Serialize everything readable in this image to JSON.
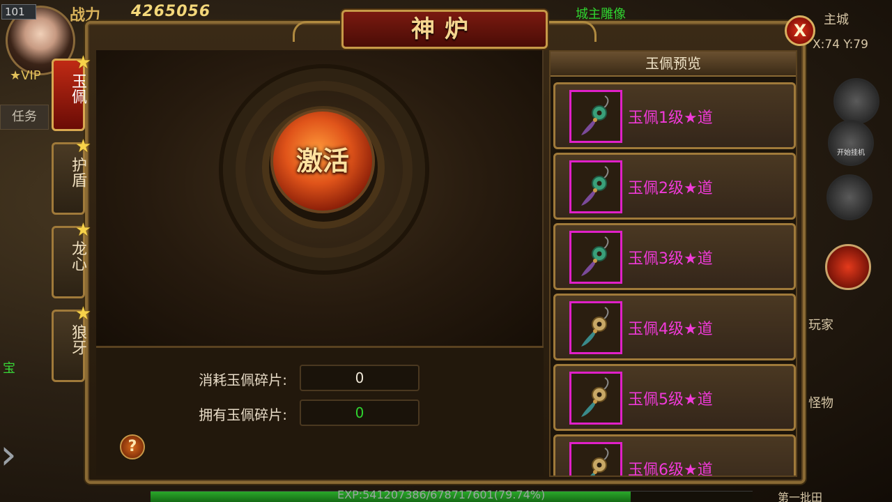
{
  "hud": {
    "level": "101",
    "power_label": "战力",
    "power_value": "4265056",
    "statue_label": "城主雕像",
    "city_label": "主城",
    "coords": "X:74 Y:79",
    "vip_label": "VIP",
    "task_label": "任务",
    "treasure_label": "宝",
    "auto_label": "开始挂机",
    "player_label": "玩家",
    "monster_label": "怪物",
    "bottom_right": "第一批田"
  },
  "panel": {
    "title": "神炉",
    "close_label": "X"
  },
  "tabs": [
    {
      "label": "玉佩",
      "active": true
    },
    {
      "label": "护盾",
      "active": false
    },
    {
      "label": "龙心",
      "active": false
    },
    {
      "label": "狼牙",
      "active": false
    }
  ],
  "furnace": {
    "activate_label": "激活"
  },
  "info": {
    "cost_label": "消耗玉佩碎片:",
    "cost_value": "0",
    "own_label": "拥有玉佩碎片:",
    "own_value": "0",
    "help_label": "?"
  },
  "preview": {
    "header": "玉佩预览",
    "items": [
      {
        "name": "玉佩1级★道",
        "icon": "jade-pendant-icon"
      },
      {
        "name": "玉佩2级★道",
        "icon": "jade-pendant-icon"
      },
      {
        "name": "玉佩3级★道",
        "icon": "jade-pendant-icon"
      },
      {
        "name": "玉佩4级★道",
        "icon": "gold-pendant-icon"
      },
      {
        "name": "玉佩5级★道",
        "icon": "gold-pendant-icon"
      },
      {
        "name": "玉佩6级★道",
        "icon": "gold-pendant-icon"
      }
    ]
  },
  "exp": {
    "text": "EXP:541207386/678717601(79.74%)",
    "percent": 79.74
  },
  "colors": {
    "item_name": "#f03ad8",
    "icon_border": "#e020c8",
    "own_value": "#2fd42f"
  }
}
